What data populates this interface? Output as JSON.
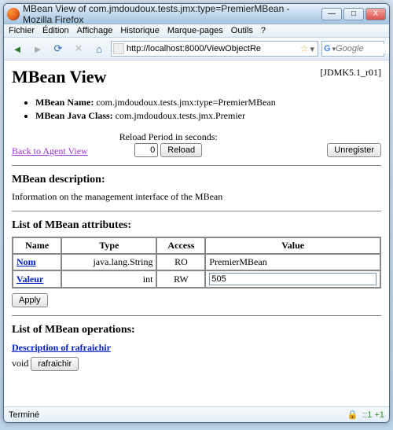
{
  "window": {
    "title": "MBean View of com.jmdoudoux.tests.jmx:type=PremierMBean - Mozilla Firefox"
  },
  "menubar": [
    "Fichier",
    "Édition",
    "Affichage",
    "Historique",
    "Marque-pages",
    "Outils",
    "?"
  ],
  "toolbar": {
    "url": "http://localhost:8000/ViewObjectRe",
    "search_placeholder": "Google"
  },
  "page": {
    "heading": "MBean View",
    "version": "[JDMK5.1_r01]",
    "mbean_name_label": "MBean Name:",
    "mbean_name_value": "com.jmdoudoux.tests.jmx:type=PremierMBean",
    "mbean_class_label": "MBean Java Class:",
    "mbean_class_value": "com.jmdoudoux.tests.jmx.Premier",
    "back_link": "Back to Agent View",
    "reload_label": "Reload Period in seconds:",
    "reload_value": "0",
    "reload_button": "Reload",
    "unregister_button": "Unregister",
    "desc_heading": "MBean description:",
    "desc_text": "Information on the management interface of the MBean",
    "attrs_heading": "List of MBean attributes:",
    "attrs_headers": {
      "name": "Name",
      "type": "Type",
      "access": "Access",
      "value": "Value"
    },
    "attrs": [
      {
        "name": "Nom",
        "type": "java.lang.String",
        "access": "RO",
        "value": "PremierMBean"
      },
      {
        "name": "Valeur",
        "type": "int",
        "access": "RW",
        "value": "505"
      }
    ],
    "apply_button": "Apply",
    "ops_heading": "List of MBean operations:",
    "op_desc_link": "Description of rafraichir",
    "op_return": "void",
    "op_button": "rafraichir"
  },
  "statusbar": {
    "status": "Terminé",
    "indicator": "::1 +1"
  }
}
